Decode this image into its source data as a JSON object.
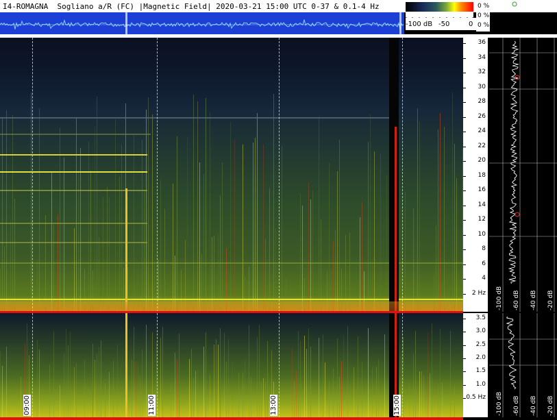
{
  "header": {
    "title": "I4-ROMAGNA  Sogliano a/R (FC) |Magnetic Field| 2020-03-21 15:00 UTC 0-37 & 0.1-4 Hz"
  },
  "colorbar": {
    "labels": [
      "-100 dB",
      "-50",
      "0"
    ],
    "percents": [
      "0 %",
      "0 %",
      "0 %"
    ]
  },
  "top_axis": {
    "ticks": [
      "36",
      "34",
      "32",
      "30",
      "28",
      "26",
      "24",
      "22",
      "20",
      "18",
      "16",
      "14",
      "12",
      "10",
      "8",
      "6",
      "4",
      "2 Hz"
    ]
  },
  "bottom_axis": {
    "ticks": [
      "3.5",
      "3.0",
      "2.5",
      "2.0",
      "1.5",
      "1.0",
      "0.5 Hz"
    ]
  },
  "profile": {
    "top_db_labels": [
      "-100 dB",
      "-60 dB",
      "-40 dB",
      "-20 dB"
    ],
    "bot_db_labels": [
      "-100 dB",
      "-60 dB",
      "-40 dB",
      "-20 dB"
    ]
  },
  "time_axis": {
    "labels": [
      "09:00",
      "11:00",
      "13:00",
      "15:00"
    ]
  },
  "colors": {
    "amp_strip": "#1d3fd6",
    "separator": "#e01010",
    "trace": "#ffffff"
  }
}
